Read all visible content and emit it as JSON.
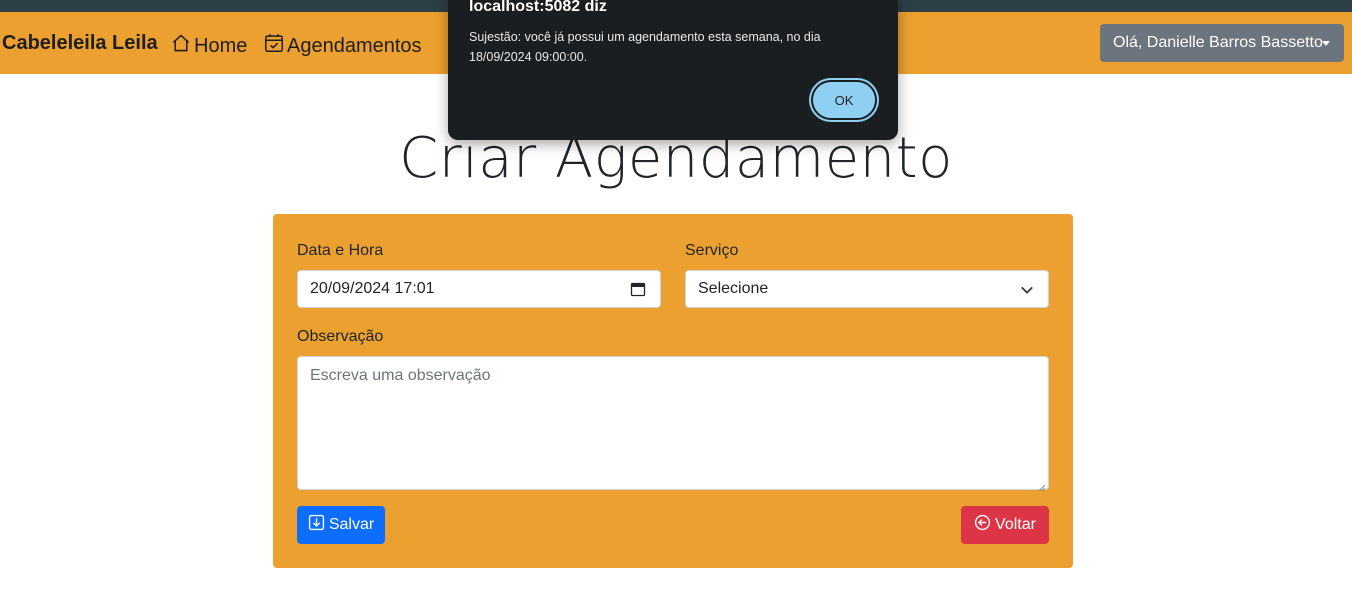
{
  "navbar": {
    "brand": "Cabeleleila Leila",
    "links": [
      {
        "label": "Home",
        "icon": "house-icon"
      },
      {
        "label": "Agendamentos",
        "icon": "calendar-check-icon"
      }
    ],
    "user_menu": "Olá, Danielle Barros Bassetto"
  },
  "page": {
    "title": "Criar Agendamento"
  },
  "form": {
    "datetime_label": "Data e Hora",
    "datetime_value": "20/09/2024 17:01",
    "service_label": "Serviço",
    "service_selected": "Selecione",
    "observation_label": "Observação",
    "observation_placeholder": "Escreva uma observação",
    "save_label": "Salvar",
    "back_label": "Voltar"
  },
  "dialog": {
    "title": "localhost:5082 diz",
    "message": "Sujestão: você já possui um agendamento esta semana, no dia 18/09/2024 09:00:00.",
    "ok_label": "OK"
  },
  "colors": {
    "accent": "#eca02f",
    "save": "#0d6efd",
    "back": "#dc3545",
    "user_button": "#6c757d"
  }
}
